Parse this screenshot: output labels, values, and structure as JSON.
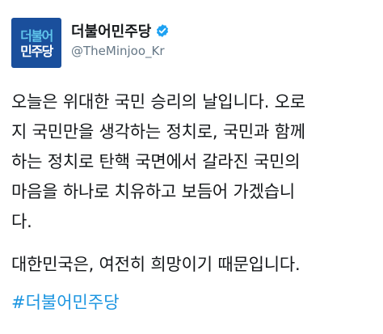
{
  "account": {
    "logo_line1": "더불어",
    "logo_line2": "민주당",
    "display_name": "더불어민주당",
    "handle": "@TheMinjoo_Kr",
    "verified_icon": "verified-badge-icon"
  },
  "tweet": {
    "lines": [
      "오늘은 위대한 국민 승리의 날입니다. 오로",
      "지 국민만을 생각하는 정치로, 국민과 함께",
      "하는 정치로 탄핵 국면에서 갈라진 국민의",
      "마음을 하나로 치유하고 보듬어 가겠습니",
      "다."
    ],
    "line2": "대한민국은, 여전히 희망이기 때문입니다.",
    "hashtag": "#더불어민주당"
  },
  "colors": {
    "logo_bg": "#1a4f9c",
    "logo_accent": "#5fc3ea",
    "verified": "#1da1f2",
    "hashtag": "#1b95e0",
    "handle": "#657786"
  }
}
